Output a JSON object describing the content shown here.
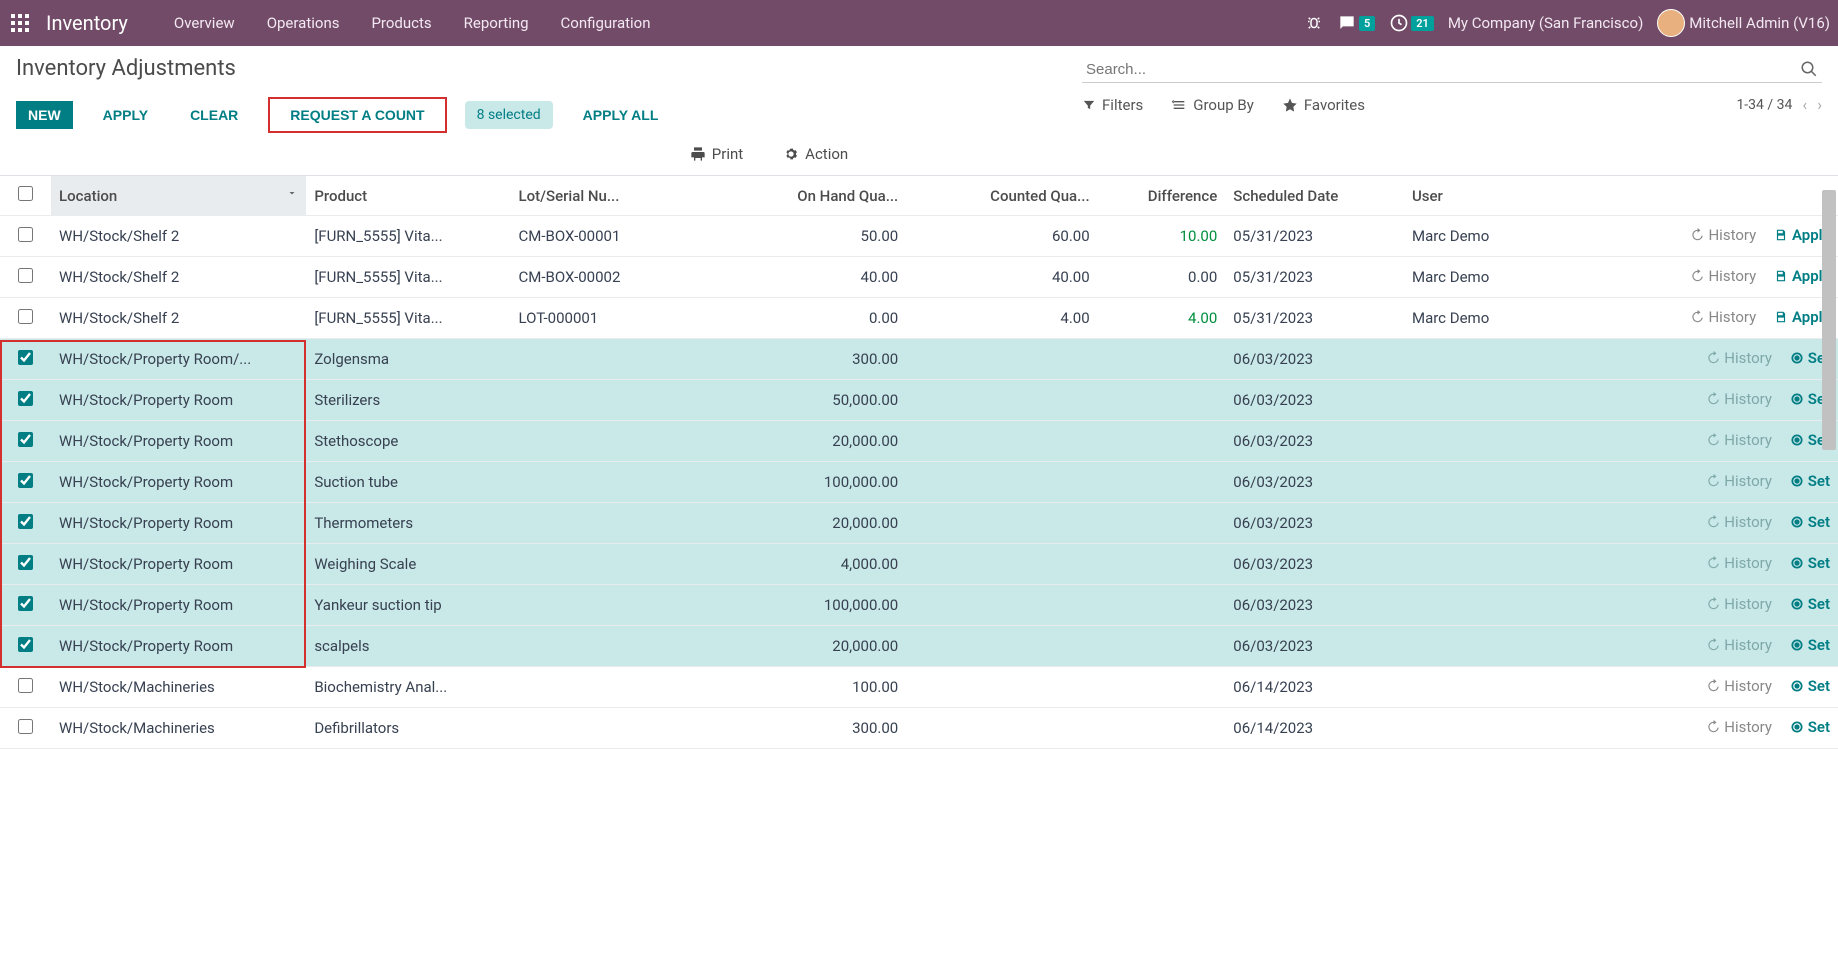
{
  "navbar": {
    "brand": "Inventory",
    "items": [
      "Overview",
      "Operations",
      "Products",
      "Reporting",
      "Configuration"
    ],
    "chat_badge": "5",
    "clock_badge": "21",
    "company": "My Company (San Francisco)",
    "user": "Mitchell Admin (V16)"
  },
  "title": "Inventory Adjustments",
  "buttons": {
    "new": "NEW",
    "apply": "APPLY",
    "clear": "CLEAR",
    "request": "REQUEST A COUNT",
    "selected": "8 selected",
    "apply_all": "APPLY ALL"
  },
  "search": {
    "placeholder": "Search..."
  },
  "pager": {
    "text": "1-34 / 34"
  },
  "filters": {
    "filters": "Filters",
    "groupby": "Group By",
    "favorites": "Favorites"
  },
  "mid": {
    "print": "Print",
    "action": "Action"
  },
  "columns": {
    "location": "Location",
    "product": "Product",
    "lot": "Lot/Serial Nu...",
    "onhand": "On Hand Qua...",
    "counted": "Counted Qua...",
    "difference": "Difference",
    "scheduled": "Scheduled Date",
    "user": "User"
  },
  "action_labels": {
    "history": "History",
    "apply": "Apply",
    "set": "Set"
  },
  "rows": [
    {
      "sel": false,
      "location": "WH/Stock/Shelf 2",
      "product": "[FURN_5555] Vita...",
      "lot": "CM-BOX-00001",
      "onhand": "50.00",
      "counted": "60.00",
      "diff": "10.00",
      "diffpos": true,
      "date": "05/31/2023",
      "user": "Marc Demo",
      "action": "apply"
    },
    {
      "sel": false,
      "location": "WH/Stock/Shelf 2",
      "product": "[FURN_5555] Vita...",
      "lot": "CM-BOX-00002",
      "onhand": "40.00",
      "counted": "40.00",
      "diff": "0.00",
      "diffpos": false,
      "date": "05/31/2023",
      "user": "Marc Demo",
      "action": "apply"
    },
    {
      "sel": false,
      "location": "WH/Stock/Shelf 2",
      "product": "[FURN_5555] Vita...",
      "lot": "LOT-000001",
      "onhand": "0.00",
      "counted": "4.00",
      "diff": "4.00",
      "diffpos": true,
      "date": "05/31/2023",
      "user": "Marc Demo",
      "action": "apply"
    },
    {
      "sel": true,
      "location": "WH/Stock/Property Room/...",
      "product": "Zolgensma",
      "lot": "",
      "onhand": "300.00",
      "counted": "",
      "diff": "",
      "diffpos": false,
      "date": "06/03/2023",
      "user": "",
      "action": "set"
    },
    {
      "sel": true,
      "location": "WH/Stock/Property Room",
      "product": "Sterilizers",
      "lot": "",
      "onhand": "50,000.00",
      "counted": "",
      "diff": "",
      "diffpos": false,
      "date": "06/03/2023",
      "user": "",
      "action": "set"
    },
    {
      "sel": true,
      "location": "WH/Stock/Property Room",
      "product": "Stethoscope",
      "lot": "",
      "onhand": "20,000.00",
      "counted": "",
      "diff": "",
      "diffpos": false,
      "date": "06/03/2023",
      "user": "",
      "action": "set"
    },
    {
      "sel": true,
      "location": "WH/Stock/Property Room",
      "product": "Suction tube",
      "lot": "",
      "onhand": "100,000.00",
      "counted": "",
      "diff": "",
      "diffpos": false,
      "date": "06/03/2023",
      "user": "",
      "action": "set"
    },
    {
      "sel": true,
      "location": "WH/Stock/Property Room",
      "product": "Thermometers",
      "lot": "",
      "onhand": "20,000.00",
      "counted": "",
      "diff": "",
      "diffpos": false,
      "date": "06/03/2023",
      "user": "",
      "action": "set"
    },
    {
      "sel": true,
      "location": "WH/Stock/Property Room",
      "product": "Weighing Scale",
      "lot": "",
      "onhand": "4,000.00",
      "counted": "",
      "diff": "",
      "diffpos": false,
      "date": "06/03/2023",
      "user": "",
      "action": "set"
    },
    {
      "sel": true,
      "location": "WH/Stock/Property Room",
      "product": "Yankeur suction tip",
      "lot": "",
      "onhand": "100,000.00",
      "counted": "",
      "diff": "",
      "diffpos": false,
      "date": "06/03/2023",
      "user": "",
      "action": "set"
    },
    {
      "sel": true,
      "location": "WH/Stock/Property Room",
      "product": "scalpels",
      "lot": "",
      "onhand": "20,000.00",
      "counted": "",
      "diff": "",
      "diffpos": false,
      "date": "06/03/2023",
      "user": "",
      "action": "set"
    },
    {
      "sel": false,
      "location": "WH/Stock/Machineries",
      "product": "Biochemistry Anal...",
      "lot": "",
      "onhand": "100.00",
      "counted": "",
      "diff": "",
      "diffpos": false,
      "date": "06/14/2023",
      "user": "",
      "action": "set"
    },
    {
      "sel": false,
      "location": "WH/Stock/Machineries",
      "product": "Defibrillators",
      "lot": "",
      "onhand": "300.00",
      "counted": "",
      "diff": "",
      "diffpos": false,
      "date": "06/14/2023",
      "user": "",
      "action": "set"
    }
  ]
}
